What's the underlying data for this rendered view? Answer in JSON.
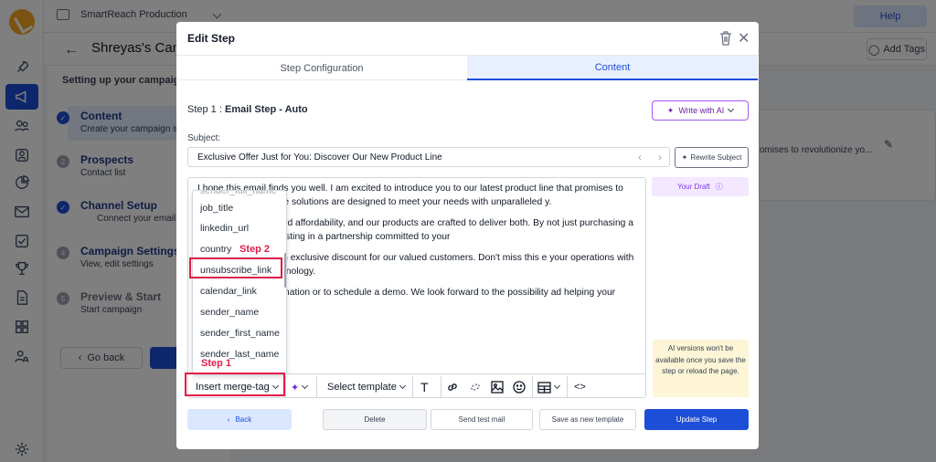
{
  "background": {
    "workspace_name": "SmartReach Production",
    "help_label": "Help",
    "campaign_title": "Shreyas's Camp",
    "add_tags_label": "Add Tags",
    "steps_heading": "Setting up your campaign",
    "steps": [
      {
        "title": "Content",
        "sub": "Create your campaign st",
        "marker": "check"
      },
      {
        "title": "Prospects",
        "sub": "Contact list",
        "marker": "2"
      },
      {
        "title": "Channel Setup",
        "sub": "Connect your email",
        "marker": "check"
      },
      {
        "title": "Campaign Settings",
        "sub": "View, edit settings",
        "marker": "4"
      },
      {
        "title": "Preview & Start",
        "sub": "Start campaign",
        "marker": "5"
      }
    ],
    "go_back_label": "Go back",
    "card_text": "omises to revolutionize yo..."
  },
  "modal": {
    "title": "Edit Step",
    "tabs": [
      "Step Configuration",
      "Content"
    ],
    "active_tab": "Content",
    "step_prefix": "Step 1 : ",
    "step_name": "Email Step - Auto",
    "write_ai_label": "Write with AI",
    "subject_label": "Subject:",
    "subject_value": "Exclusive Offer Just for You: Discover Our New Product Line",
    "rewrite_label": "Rewrite Subject",
    "body_paragraphs": [
      "I hope this email finds you well. I am excited to introduce you to our latest product line that promises to                             rience. Our innovative solutions are designed to meet your needs with unparalleled                             y.",
      "                         portance of quality and affordability, and our products are crafted to deliver both. By                             not just purchasing a product; you are investing in a partnership committed to your",
      "                         ch, we are offering an exclusive discount for our valued customers. Don't miss this                             e your operations with our cutting-edge technology.",
      "                         ch out for more information or to schedule a demo. We look forward to the possibility                             ad helping your business thrive."
    ],
    "merge_tags": [
      "job_title",
      "linkedin_url",
      "country",
      "unsubscribe_link",
      "calendar_link",
      "sender_name",
      "sender_first_name",
      "sender_last_name",
      "sender_full_name"
    ],
    "selected_merge_tag": "unsubscribe_link",
    "toolbar": {
      "merge_tag_label": "Insert merge-tag",
      "template_label": "Select template"
    },
    "annotations": {
      "step1": "Step 1",
      "step2": "Step 2"
    },
    "draft_label": "Your Draft",
    "ai_note": "AI versions won't be available once you save the step or reload the page.",
    "footer": {
      "back": "Back",
      "delete": "Delete",
      "test": "Send test mail",
      "template": "Save as new template",
      "update": "Update Step"
    }
  },
  "colors": {
    "accent": "#1d4ed8",
    "annotation": "#e11d48",
    "ai_purple": "#a855f7",
    "note_bg": "#fdf5d6"
  }
}
